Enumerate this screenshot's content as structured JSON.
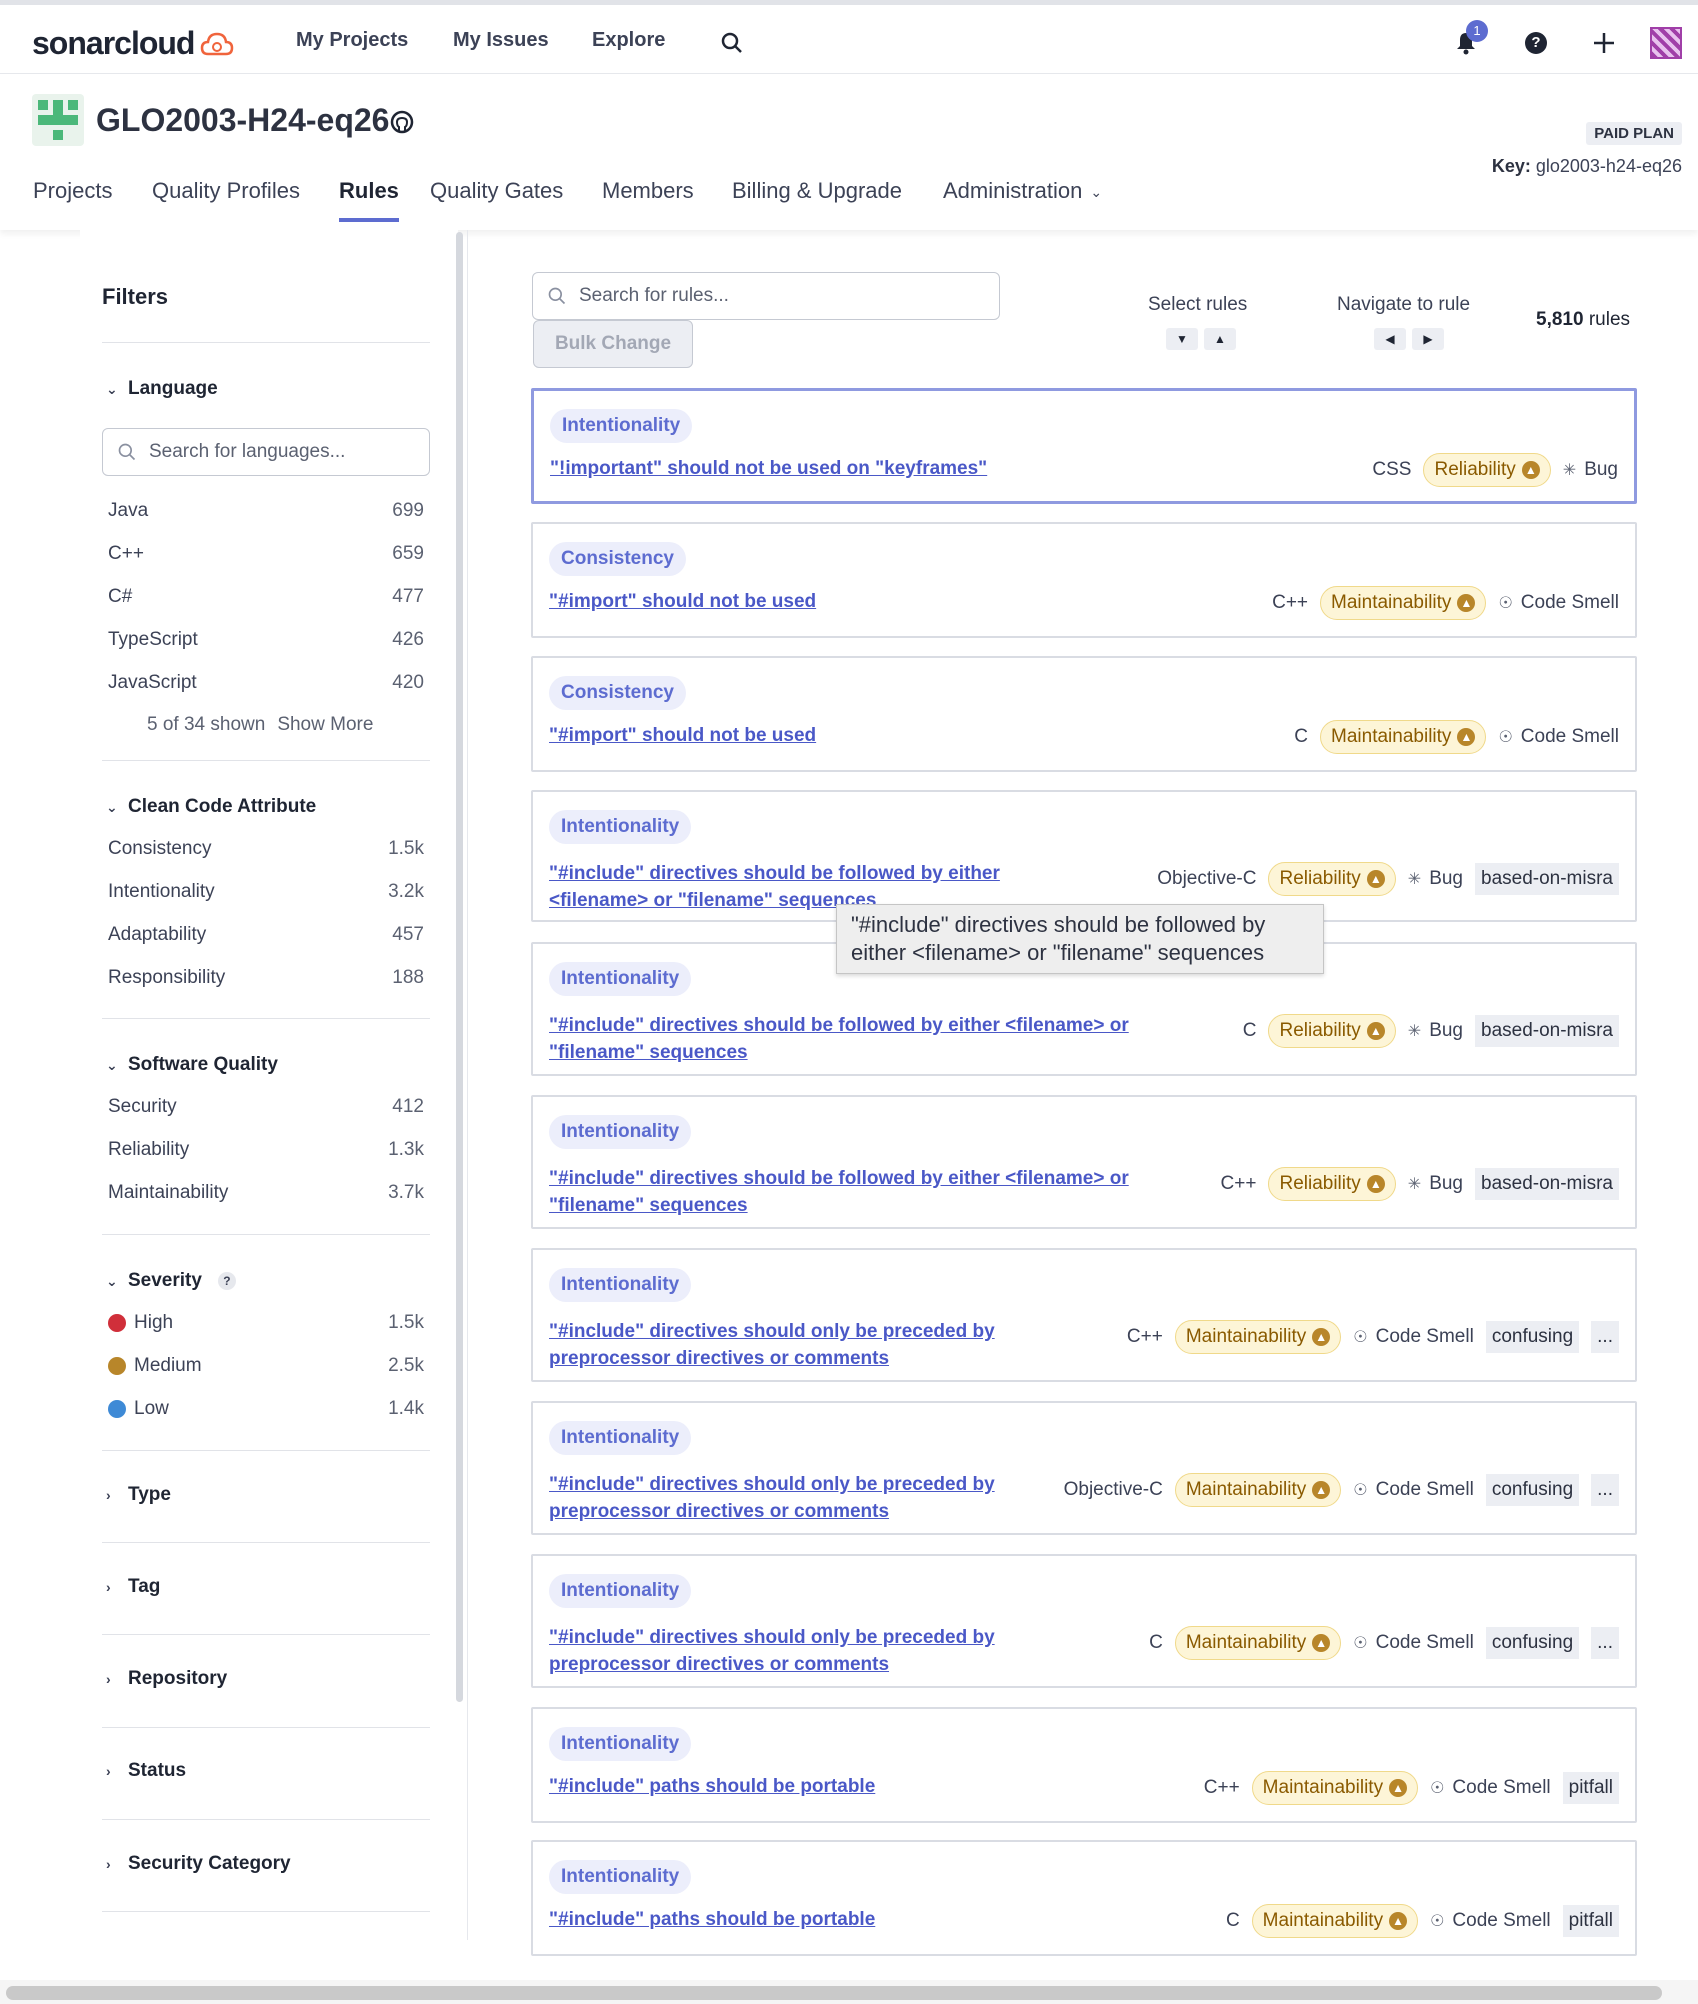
{
  "topnav": {
    "logo": "sonarcloud",
    "links": [
      "My Projects",
      "My Issues",
      "Explore"
    ],
    "notification_count": "1"
  },
  "project": {
    "name": "GLO2003-H24-eq26",
    "plan": "PAID PLAN",
    "key_label": "Key:",
    "key_value": "glo2003-h24-eq26",
    "tabs": [
      "Projects",
      "Quality Profiles",
      "Rules",
      "Quality Gates",
      "Members",
      "Billing & Upgrade",
      "Administration"
    ],
    "active_tab": "Rules"
  },
  "sidebar": {
    "title": "Filters",
    "language": {
      "label": "Language",
      "search_placeholder": "Search for languages...",
      "items": [
        {
          "label": "Java",
          "count": "699"
        },
        {
          "label": "C++",
          "count": "659"
        },
        {
          "label": "C#",
          "count": "477"
        },
        {
          "label": "TypeScript",
          "count": "426"
        },
        {
          "label": "JavaScript",
          "count": "420"
        }
      ],
      "shown_text": "5 of 34 shown",
      "show_more": "Show More"
    },
    "clean_code": {
      "label": "Clean Code Attribute",
      "items": [
        {
          "label": "Consistency",
          "count": "1.5k"
        },
        {
          "label": "Intentionality",
          "count": "3.2k"
        },
        {
          "label": "Adaptability",
          "count": "457"
        },
        {
          "label": "Responsibility",
          "count": "188"
        }
      ]
    },
    "software_quality": {
      "label": "Software Quality",
      "items": [
        {
          "label": "Security",
          "count": "412"
        },
        {
          "label": "Reliability",
          "count": "1.3k"
        },
        {
          "label": "Maintainability",
          "count": "3.7k"
        }
      ]
    },
    "severity": {
      "label": "Severity",
      "help": "?",
      "items": [
        {
          "label": "High",
          "count": "1.5k",
          "color": "#d02f3a"
        },
        {
          "label": "Medium",
          "count": "2.5k",
          "color": "#b8862a"
        },
        {
          "label": "Low",
          "count": "1.4k",
          "color": "#3e8ad6"
        }
      ]
    },
    "collapsed": [
      "Type",
      "Tag",
      "Repository",
      "Status",
      "Security Category"
    ]
  },
  "main": {
    "search_placeholder": "Search for rules...",
    "bulk_change": "Bulk Change",
    "select_rules": "Select rules",
    "navigate_rule": "Navigate to rule",
    "rules_count": "5,810",
    "rules_word": "rules",
    "tooltip": "\"#include\" directives should be followed by either <filename> or \"filename\" sequences",
    "rules": [
      {
        "attr": "Intentionality",
        "title1": "\"!important\" should not be used on \"keyframes\"",
        "title2": "",
        "lang": "CSS",
        "quality": "Reliability",
        "type": "Bug",
        "tags": []
      },
      {
        "attr": "Consistency",
        "title1": "\"#import\" should not be used",
        "title2": "",
        "lang": "C++",
        "quality": "Maintainability",
        "type": "Code Smell",
        "tags": []
      },
      {
        "attr": "Consistency",
        "title1": "\"#import\" should not be used",
        "title2": "",
        "lang": "C",
        "quality": "Maintainability",
        "type": "Code Smell",
        "tags": []
      },
      {
        "attr": "Intentionality",
        "title1": "\"#include\" directives should be followed by either",
        "title2": "<filename> or \"filename\" sequences",
        "lang": "Objective-C",
        "quality": "Reliability",
        "type": "Bug",
        "tags": [
          "based-on-misra"
        ]
      },
      {
        "attr": "Intentionality",
        "title1": "\"#include\" directives should be followed by either <filename> or",
        "title2": "\"filename\" sequences",
        "lang": "C",
        "quality": "Reliability",
        "type": "Bug",
        "tags": [
          "based-on-misra"
        ]
      },
      {
        "attr": "Intentionality",
        "title1": "\"#include\" directives should be followed by either <filename> or",
        "title2": "\"filename\" sequences",
        "lang": "C++",
        "quality": "Reliability",
        "type": "Bug",
        "tags": [
          "based-on-misra"
        ]
      },
      {
        "attr": "Intentionality",
        "title1": "\"#include\" directives should only be preceded by",
        "title2": "preprocessor directives or comments",
        "lang": "C++",
        "quality": "Maintainability",
        "type": "Code Smell",
        "tags": [
          "confusing",
          "..."
        ]
      },
      {
        "attr": "Intentionality",
        "title1": "\"#include\" directives should only be preceded by",
        "title2": "preprocessor directives or comments",
        "lang": "Objective-C",
        "quality": "Maintainability",
        "type": "Code Smell",
        "tags": [
          "confusing",
          "..."
        ]
      },
      {
        "attr": "Intentionality",
        "title1": "\"#include\" directives should only be preceded by",
        "title2": "preprocessor directives or comments",
        "lang": "C",
        "quality": "Maintainability",
        "type": "Code Smell",
        "tags": [
          "confusing",
          "..."
        ]
      },
      {
        "attr": "Intentionality",
        "title1": "\"#include\" paths should be portable",
        "title2": "",
        "lang": "C++",
        "quality": "Maintainability",
        "type": "Code Smell",
        "tags": [
          "pitfall"
        ]
      },
      {
        "attr": "Intentionality",
        "title1": "\"#include\" paths should be portable",
        "title2": "",
        "lang": "C",
        "quality": "Maintainability",
        "type": "Code Smell",
        "tags": [
          "pitfall"
        ]
      }
    ]
  }
}
